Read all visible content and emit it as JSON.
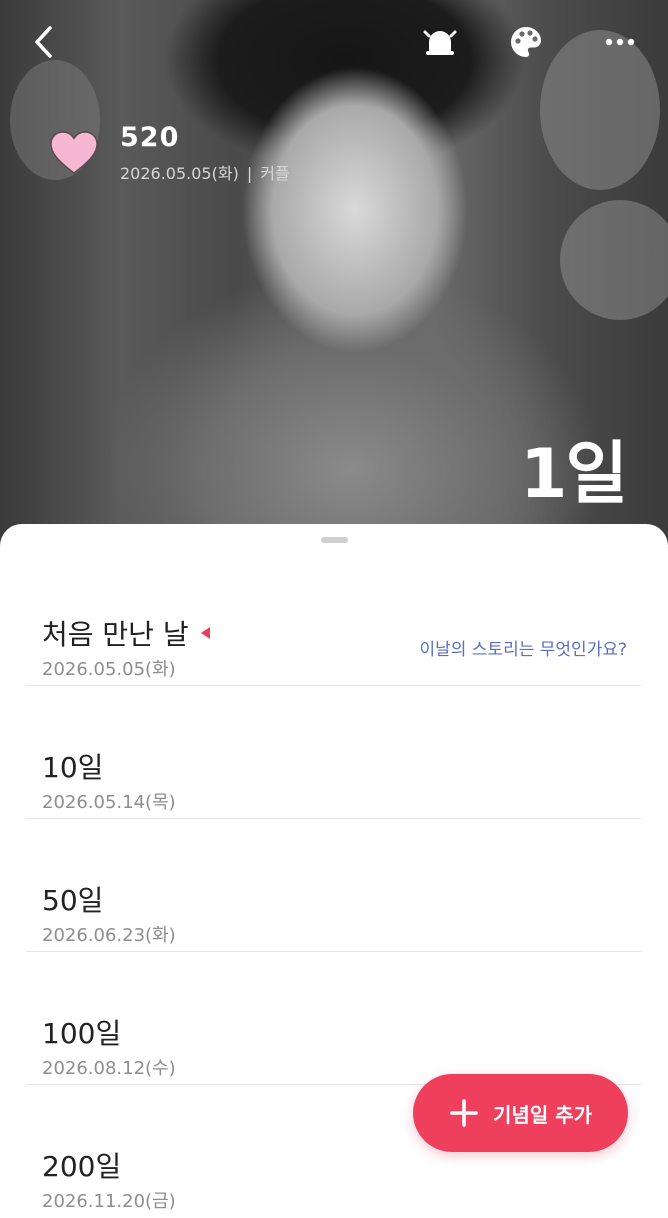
{
  "header": {
    "couple_name": "520",
    "start_date": "2026.05.05(화)",
    "separator": "|",
    "category": "커플",
    "day_count": "1일",
    "icons": [
      "back-arrow-icon",
      "alarm-bell-icon",
      "palette-icon",
      "more-icon"
    ],
    "heart_color": "#f6b7d2"
  },
  "anniversaries": [
    {
      "title": "처음 만난 날",
      "date": "2026.05.05(화)",
      "story_prompt": "이날의 스토리는 무엇인가요?"
    },
    {
      "title": "10일",
      "date": "2026.05.14(목)"
    },
    {
      "title": "50일",
      "date": "2026.06.23(화)"
    },
    {
      "title": "100일",
      "date": "2026.08.12(수)"
    },
    {
      "title": "200일",
      "date": "2026.11.20(금)"
    }
  ],
  "fab": {
    "label": "기념일 추가",
    "color": "#ee3f5c"
  },
  "colors": {
    "accent": "#ee3f5c",
    "link": "#5a70c8"
  }
}
